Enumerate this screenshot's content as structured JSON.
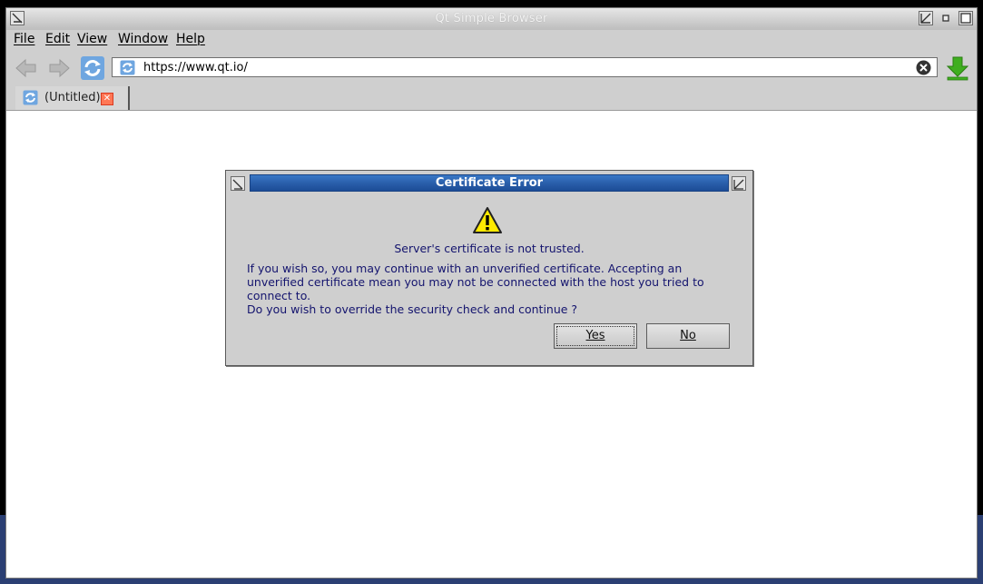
{
  "window": {
    "title": "Qt Simple Browser"
  },
  "menubar": {
    "items": [
      "File",
      "Edit",
      "View",
      "Window",
      "Help"
    ]
  },
  "toolbar": {
    "icons": [
      "back-arrow-icon",
      "forward-arrow-icon",
      "reload-icon",
      "download-icon"
    ],
    "url": "https://www.qt.io/"
  },
  "tabs": [
    {
      "label": "(Untitled)"
    }
  ],
  "dialog": {
    "title": "Certificate Error",
    "heading": "Server's certificate is not trusted.",
    "body": "If you wish so, you may continue with an unverified certificate. Accepting an unverified certificate mean you may not be connected with the host you tried to connect to.",
    "question": "Do you wish to override the security check and continue ?",
    "yes_label": "Yes",
    "no_label": "No"
  },
  "colors": {
    "dialog_title_bg": "#2a5fab",
    "message_text": "#14146e",
    "tab_close": "#ff7755",
    "download_green": "#3fae1f"
  }
}
